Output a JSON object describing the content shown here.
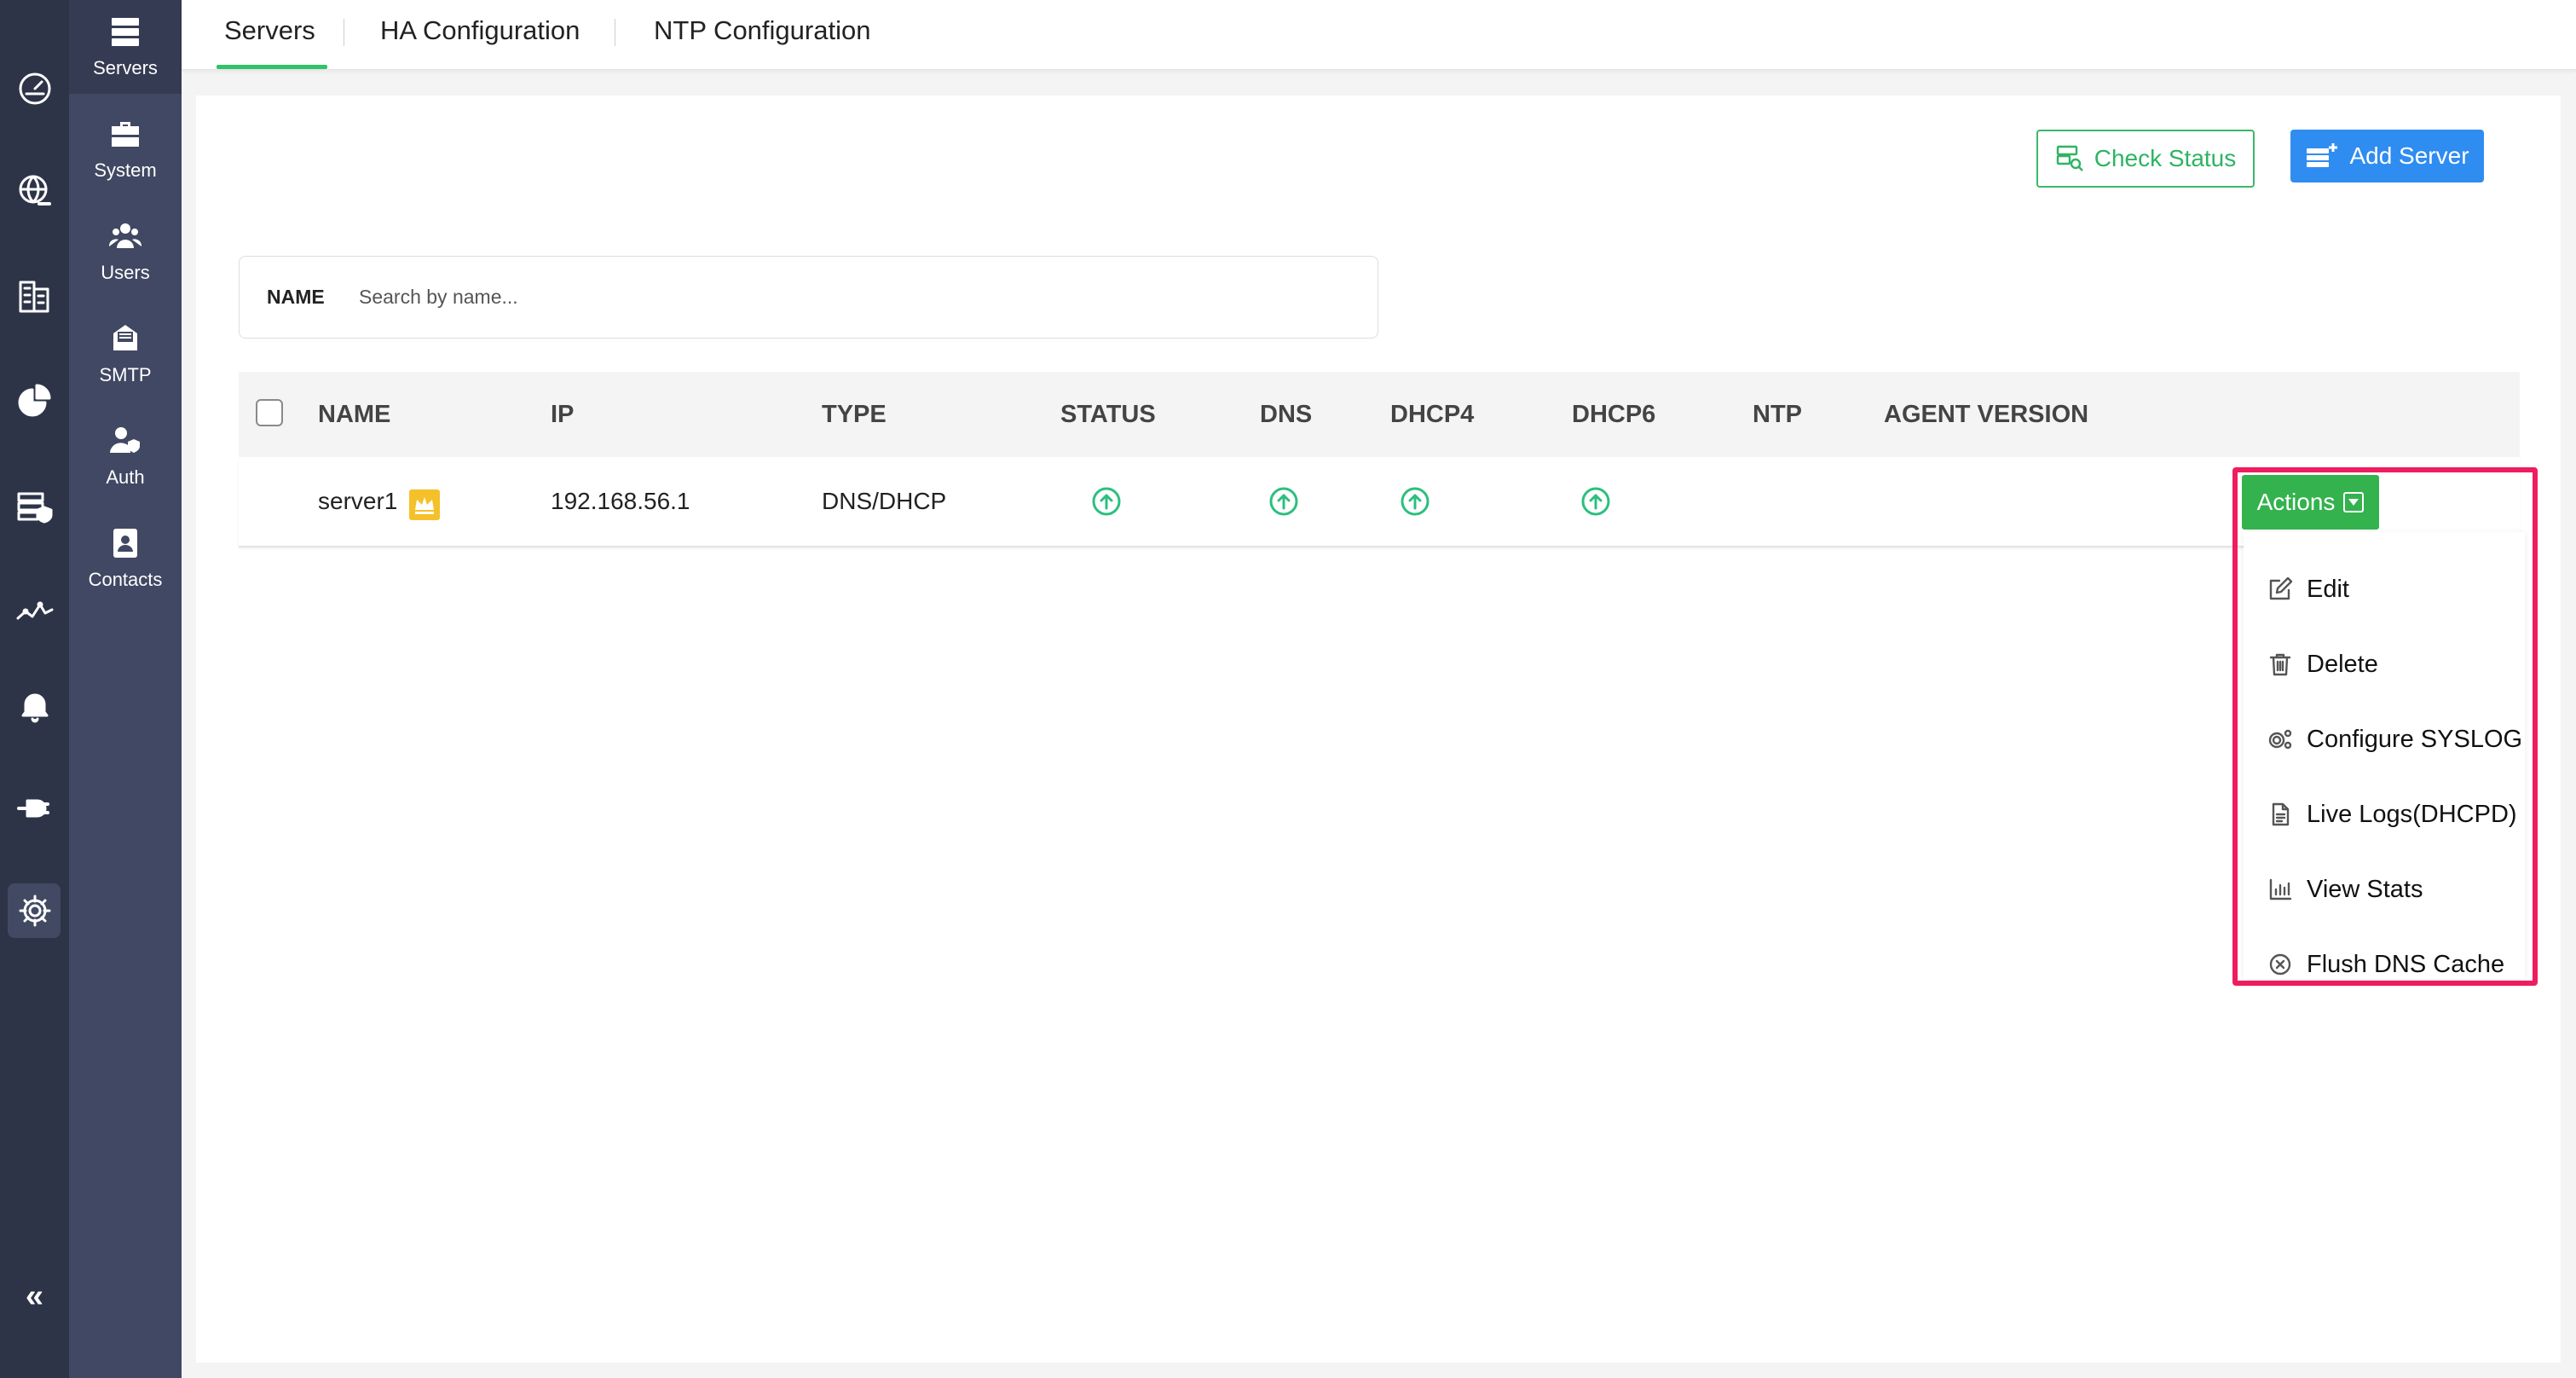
{
  "icon_rail": {
    "items": [
      {
        "name": "dashboard-icon"
      },
      {
        "name": "dns-globe-icon"
      },
      {
        "name": "ipam-icon"
      },
      {
        "name": "reports-pie-icon"
      },
      {
        "name": "security-server-icon"
      },
      {
        "name": "monitoring-icon"
      },
      {
        "name": "alerts-bell-icon"
      },
      {
        "name": "integrations-plug-icon"
      },
      {
        "name": "settings-gear-icon"
      }
    ],
    "collapse_label": "«"
  },
  "submenu": {
    "items": [
      {
        "label": "Servers",
        "icon": "servers-icon"
      },
      {
        "label": "System",
        "icon": "system-icon"
      },
      {
        "label": "Users",
        "icon": "users-icon"
      },
      {
        "label": "SMTP",
        "icon": "smtp-icon"
      },
      {
        "label": "Auth",
        "icon": "auth-icon"
      },
      {
        "label": "Contacts",
        "icon": "contacts-icon"
      }
    ]
  },
  "tabs": [
    {
      "label": "Servers",
      "active": true
    },
    {
      "label": "HA Configuration",
      "active": false
    },
    {
      "label": "NTP Configuration",
      "active": false
    }
  ],
  "toolbar": {
    "check_status_label": "Check Status",
    "add_server_label": "Add Server"
  },
  "search": {
    "label": "NAME",
    "placeholder": "Search by name..."
  },
  "table": {
    "columns": [
      "NAME",
      "IP",
      "TYPE",
      "STATUS",
      "DNS",
      "DHCP4",
      "DHCP6",
      "NTP",
      "AGENT VERSION"
    ],
    "rows": [
      {
        "name": "server1",
        "ip": "192.168.56.1",
        "type": "DNS/DHCP",
        "status": "up",
        "dns": "up",
        "dhcp4": "up",
        "dhcp6": "up",
        "ntp": "",
        "agent_version": ""
      }
    ]
  },
  "actions": {
    "button_label": "Actions",
    "menu": [
      {
        "label": "Edit",
        "icon": "edit-icon"
      },
      {
        "label": "Delete",
        "icon": "trash-icon"
      },
      {
        "label": "Configure SYSLOG",
        "icon": "gears-icon"
      },
      {
        "label": "Live Logs(DHCPD)",
        "icon": "document-icon"
      },
      {
        "label": "View Stats",
        "icon": "bar-chart-icon"
      },
      {
        "label": "Flush DNS Cache",
        "icon": "circle-x-icon"
      }
    ]
  },
  "colors": {
    "rail_bg": "#2e3448",
    "submenu_bg": "#414863",
    "accent_green": "#31c26a",
    "add_button_blue": "#2f8cf0",
    "actions_green": "#33b24e",
    "highlight_pink": "#ee1d5f",
    "status_up": "#2cbf7f"
  }
}
